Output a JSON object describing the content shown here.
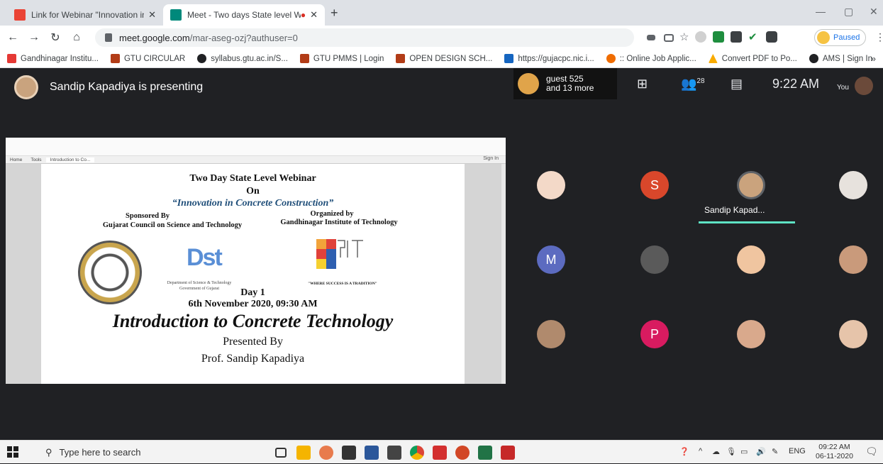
{
  "browser": {
    "tabs": [
      {
        "title": "Link for Webinar \"Innovation in C",
        "active": false
      },
      {
        "title": "Meet - Two days State level W",
        "active": true
      }
    ],
    "url_host": "meet.google.com",
    "url_path": "/mar-aseg-ozj?authuser=0",
    "profile_status": "Paused",
    "bookmarks": [
      "Gandhinagar Institu...",
      "GTU CIRCULAR",
      "syllabus.gtu.ac.in/S...",
      "GTU PMMS | Login",
      "OPEN DESIGN SCH...",
      "https://gujacpc.nic.i...",
      ":: Online Job Applic...",
      "Convert PDF to Po...",
      "AMS | Sign In"
    ]
  },
  "meet": {
    "presenter_text": "Sandip Kapadiya is presenting",
    "guest_line1": "guest 525",
    "guest_line2": "and 13 more",
    "participant_count": "28",
    "time": "9:22 AM",
    "you_label": "You",
    "speaker_label": "Sandip Kapad...",
    "tiles": [
      {
        "initial": "",
        "color": "#f3d9c8"
      },
      {
        "initial": "S",
        "color": "#d9472b"
      },
      {
        "initial": "",
        "color": "#caa37d"
      },
      {
        "initial": "",
        "color": "#e7e2dd"
      },
      {
        "initial": "M",
        "color": "#5c6bc0"
      },
      {
        "initial": "",
        "color": "#5a5a5a"
      },
      {
        "initial": "",
        "color": "#f0c5a0"
      },
      {
        "initial": "",
        "color": "#c99a7b"
      },
      {
        "initial": "",
        "color": "#b08a6d"
      },
      {
        "initial": "P",
        "color": "#d81b60"
      },
      {
        "initial": "",
        "color": "#d9a98c"
      },
      {
        "initial": "",
        "color": "#e6c4aa"
      }
    ]
  },
  "acrobat": {
    "menu_tabs": [
      "Home",
      "Tools",
      "Introduction to Co..."
    ],
    "sign_in": "Sign In"
  },
  "slide": {
    "title": "Two Day State Level Webinar",
    "on": "On",
    "subtitle": "“Innovation in Concrete Construction”",
    "sponsored_by": "Sponsored By",
    "sponsor": "Gujarat Council on Science and Technology",
    "organized_by": "Organized by",
    "organizer": "Gandhinagar Institute of Technology",
    "dst_logo": "Dst",
    "dst_caption": "Department of Science & Technology Government of Gujarat",
    "git_caption": "\"WHERE SUCCESS IS A TRADITION\"",
    "day": "Day 1",
    "date": "6th November 2020, 09:30 AM",
    "topic": "Introduction to Concrete Technology",
    "presented_by": "Presented By",
    "presenter": "Prof. Sandip Kapadiya"
  },
  "taskbar": {
    "search_placeholder": "Type here to search",
    "lang": "ENG",
    "time": "09:22 AM",
    "date": "06-11-2020"
  }
}
